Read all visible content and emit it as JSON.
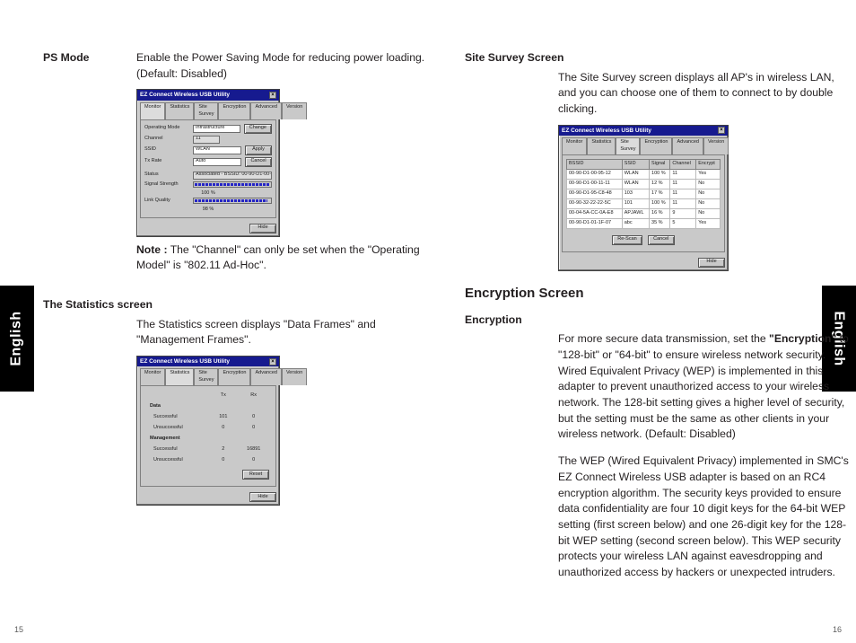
{
  "sidebar": {
    "language": "English"
  },
  "pages": {
    "left": "15",
    "right": "16"
  },
  "left": {
    "psmode": {
      "label": "PS Mode",
      "text": "Enable the Power Saving Mode for reducing power loading. (Default: Disabled)"
    },
    "note": {
      "label": "Note :",
      "text": "The \"Channel\" can only be set when the \"Operating Model\" is \"802.11 Ad-Hoc\"."
    },
    "stats": {
      "heading": "The Statistics screen",
      "text": "The Statistics screen displays \"Data Frames\" and \"Management Frames\"."
    }
  },
  "right": {
    "site": {
      "heading": "Site Survey Screen",
      "text": "The Site Survey screen displays all AP's in wireless LAN, and you can choose one of them to connect to by double clicking."
    },
    "enc": {
      "h2": "Encryption Screen",
      "heading": "Encryption",
      "p1a": "For more secure data transmission, set the ",
      "p1b": "\"Encryption\"",
      "p1c": " to \"128-bit\" or \"64-bit\" to ensure wireless network security. Wired Equivalent Privacy (WEP) is implemented in this adapter to prevent unauthorized access to your wireless network. The 128-bit setting gives a higher level of security, but the setting must be the same as other clients in your wireless network. (Default: Disabled)",
      "p2": "The WEP (Wired Equivalent Privacy) implemented in SMC's EZ Connect Wireless USB adapter is based on an RC4 encryption algorithm. The security keys provided to ensure data confidentiality are four 10 digit keys for the 64-bit WEP setting (first screen below) and one 26-digit key for the 128-bit WEP setting (second screen below). This WEP security protects your wireless LAN against eavesdropping and unauthorized access by hackers or unexpected intruders."
    }
  },
  "win": {
    "title": "EZ Connect Wireless USB Utility",
    "tabs": [
      "Monitor",
      "Statistics",
      "Site Survey",
      "Encryption",
      "Advanced",
      "Version"
    ],
    "buttons": {
      "apply": "Apply",
      "cancel": "Cancel",
      "change": "Change",
      "hide": "Hide",
      "reset": "Reset",
      "rescan": "Re-Scan"
    },
    "monitor": {
      "fields": {
        "opmode": {
          "label": "Operating Mode",
          "value": "Infrastructure"
        },
        "channel": {
          "label": "Channel",
          "value": "11"
        },
        "ssid": {
          "label": "SSID",
          "value": "WLAN"
        },
        "txrate": {
          "label": "Tx Rate",
          "value": "Auto"
        },
        "status": {
          "label": "Status",
          "value": "Associated - BSSID: 00-90-D1-00-95-12"
        },
        "signal": {
          "label": "Signal Strength",
          "pct": "100 %"
        },
        "link": {
          "label": "Link Quality",
          "pct": "98 %"
        }
      }
    },
    "stats": {
      "cols": [
        "Tx",
        "Rx"
      ],
      "groups": {
        "data": {
          "label": "Data",
          "rows": [
            {
              "name": "Successful",
              "tx": "101",
              "rx": "0"
            },
            {
              "name": "Unsuccessful",
              "tx": "0",
              "rx": "0"
            }
          ]
        },
        "mgmt": {
          "label": "Management",
          "rows": [
            {
              "name": "Successful",
              "tx": "2",
              "rx": "16891"
            },
            {
              "name": "Unsuccessful",
              "tx": "0",
              "rx": "0"
            }
          ]
        }
      }
    },
    "survey": {
      "cols": [
        "BSSID",
        "SSID",
        "Signal",
        "Channel",
        "Encrypt"
      ],
      "rows": [
        {
          "b": "00-90-D1-00-95-12",
          "s": "WLAN",
          "sig": "100 %",
          "ch": "11",
          "e": "Yes"
        },
        {
          "b": "00-90-D1-00-11-11",
          "s": "WLAN",
          "sig": "12 %",
          "ch": "11",
          "e": "No"
        },
        {
          "b": "00-90-D1-95-C8-48",
          "s": "103",
          "sig": "17 %",
          "ch": "11",
          "e": "No"
        },
        {
          "b": "00-90-32-22-22-5C",
          "s": "101",
          "sig": "100 %",
          "ch": "11",
          "e": "No"
        },
        {
          "b": "00-04-5A-CC-0A-E8",
          "s": "APJAWL",
          "sig": "16 %",
          "ch": "9",
          "e": "No"
        },
        {
          "b": "00-90-D1-01-1F-07",
          "s": "abc",
          "sig": "35 %",
          "ch": "5",
          "e": "Yes"
        }
      ]
    }
  }
}
